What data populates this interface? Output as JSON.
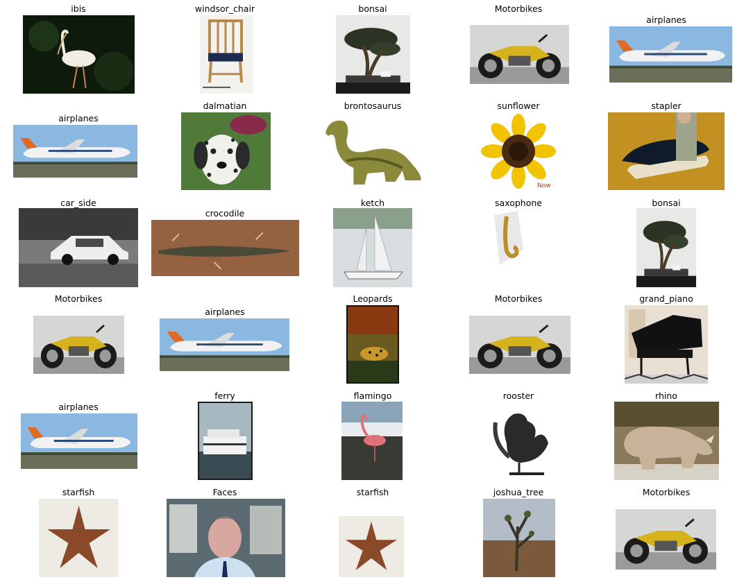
{
  "grid": {
    "rows": 6,
    "columns": 5,
    "items": [
      {
        "label": "ibis",
        "icon": "ibis-photo"
      },
      {
        "label": "windsor_chair",
        "icon": "windsor-chair-photo"
      },
      {
        "label": "bonsai",
        "icon": "bonsai-photo"
      },
      {
        "label": "Motorbikes",
        "icon": "motorbike-photo"
      },
      {
        "label": "airplanes",
        "icon": "airplane-photo"
      },
      {
        "label": "airplanes",
        "icon": "airplane-photo"
      },
      {
        "label": "dalmatian",
        "icon": "dalmatian-photo"
      },
      {
        "label": "brontosaurus",
        "icon": "brontosaurus-photo"
      },
      {
        "label": "sunflower",
        "icon": "sunflower-photo",
        "overlay": "Now"
      },
      {
        "label": "stapler",
        "icon": "stapler-photo"
      },
      {
        "label": "car_side",
        "icon": "car-photo"
      },
      {
        "label": "crocodile",
        "icon": "crocodile-photo"
      },
      {
        "label": "ketch",
        "icon": "ketch-photo"
      },
      {
        "label": "saxophone",
        "icon": "saxophone-photo"
      },
      {
        "label": "bonsai",
        "icon": "bonsai-photo"
      },
      {
        "label": "Motorbikes",
        "icon": "motorbike-photo"
      },
      {
        "label": "airplanes",
        "icon": "airplane-photo"
      },
      {
        "label": "Leopards",
        "icon": "leopard-photo"
      },
      {
        "label": "Motorbikes",
        "icon": "motorbike-photo"
      },
      {
        "label": "grand_piano",
        "icon": "grand-piano-photo"
      },
      {
        "label": "airplanes",
        "icon": "airplane-photo"
      },
      {
        "label": "ferry",
        "icon": "ferry-photo"
      },
      {
        "label": "flamingo",
        "icon": "flamingo-photo"
      },
      {
        "label": "rooster",
        "icon": "rooster-photo"
      },
      {
        "label": "rhino",
        "icon": "rhino-photo"
      },
      {
        "label": "starfish",
        "icon": "starfish-photo"
      },
      {
        "label": "Faces",
        "icon": "face-photo"
      },
      {
        "label": "starfish",
        "icon": "starfish-photo"
      },
      {
        "label": "joshua_tree",
        "icon": "joshua-tree-photo"
      },
      {
        "label": "Motorbikes",
        "icon": "motorbike-photo"
      }
    ]
  }
}
